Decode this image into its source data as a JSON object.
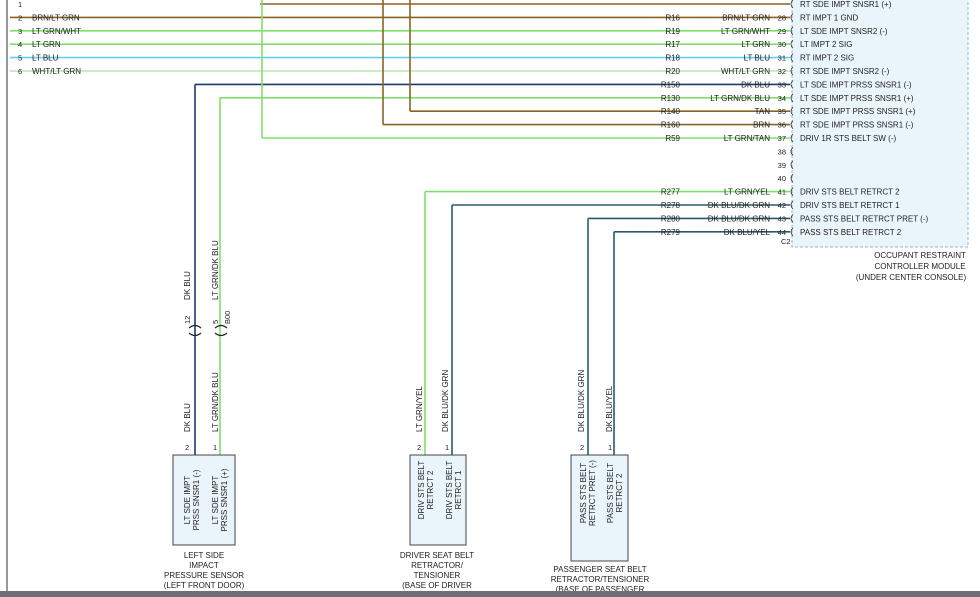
{
  "colors": {
    "brn_lt_grn": "#8a6420",
    "lt_grn": "#7ee06a",
    "lt_blu": "#5fd0f0",
    "dk_blu": "#1c3a6e",
    "dk_blu_dk_grn": "#2a5a6a",
    "brn": "#8a6420",
    "module_fill": "#eaf5fb",
    "connector_fill": "#eaf5fb",
    "bottom_bar": "#6e6e78"
  },
  "left_connector": {
    "rows": [
      {
        "pin": "1",
        "label": "",
        "color": "#8a6420"
      },
      {
        "pin": "2",
        "label": "BRN/LT GRN",
        "color": "#8a6420"
      },
      {
        "pin": "3",
        "label": "LT GRN/WHT",
        "color": "#7ee06a"
      },
      {
        "pin": "4",
        "label": "LT GRN",
        "color": "#7ee06a"
      },
      {
        "pin": "5",
        "label": "LT BLU",
        "color": "#5fd0f0"
      },
      {
        "pin": "6",
        "label": "WHT/LT GRN",
        "color": "#b8e8b0"
      }
    ]
  },
  "module": {
    "name_lines": [
      "OCCUPANT RESTRAINT",
      "CONTROLLER MODULE",
      "(UNDER CENTER CONSOLE)"
    ],
    "connector_id": "C2",
    "pins": [
      {
        "pin": "",
        "circuit": "",
        "wire": "",
        "label": "RT SDE IMPT SNSR1 (+)",
        "color": "#8a6420"
      },
      {
        "pin": "28",
        "circuit": "R16",
        "wire": "BRN/LT GRN",
        "label": "RT IMPT 1 GND",
        "color": "#8a6420"
      },
      {
        "pin": "29",
        "circuit": "R19",
        "wire": "LT GRN/WHT",
        "label": "LT SDE IMPT SNSR2 (-)",
        "color": "#7ee06a"
      },
      {
        "pin": "30",
        "circuit": "R17",
        "wire": "LT GRN",
        "label": "LT IMPT 2 SIG",
        "color": "#7ee06a"
      },
      {
        "pin": "31",
        "circuit": "R18",
        "wire": "LT BLU",
        "label": "RT IMPT 2 SIG",
        "color": "#5fd0f0"
      },
      {
        "pin": "32",
        "circuit": "R20",
        "wire": "WHT/LT GRN",
        "label": "RT SDE IMPT SNSR2 (-)",
        "color": "#b8e8b0"
      },
      {
        "pin": "33",
        "circuit": "R150",
        "wire": "DK BLU",
        "label": "LT SDE IMPT PRSS SNSR1 (-)",
        "color": "#1c3a6e"
      },
      {
        "pin": "34",
        "circuit": "R130",
        "wire": "LT GRN/DK BLU",
        "label": "LT SDE IMPT PRSS SNSR1 (+)",
        "color": "#7ee06a"
      },
      {
        "pin": "35",
        "circuit": "R140",
        "wire": "TAN",
        "label": "RT SDE IMPT PRSS SNSR1 (+)",
        "color": "#8a6420"
      },
      {
        "pin": "36",
        "circuit": "R160",
        "wire": "BRN",
        "label": "RT SDE IMPT PRSS SNSR1 (-)",
        "color": "#8a6420"
      },
      {
        "pin": "37",
        "circuit": "R59",
        "wire": "LT GRN/TAN",
        "label": "DRIV 1R STS BELT SW (-)",
        "color": "#7ee06a"
      },
      {
        "pin": "38",
        "circuit": "",
        "wire": "",
        "label": "",
        "color": ""
      },
      {
        "pin": "39",
        "circuit": "",
        "wire": "",
        "label": "",
        "color": ""
      },
      {
        "pin": "40",
        "circuit": "",
        "wire": "",
        "label": "",
        "color": ""
      },
      {
        "pin": "41",
        "circuit": "R277",
        "wire": "LT GRN/YEL",
        "label": "DRIV STS BELT RETRCT 2",
        "color": "#7ee06a"
      },
      {
        "pin": "42",
        "circuit": "R278",
        "wire": "DK BLU/DK GRN",
        "label": "DRIV STS BELT RETRCT 1",
        "color": "#2a5a6a"
      },
      {
        "pin": "43",
        "circuit": "R280",
        "wire": "DK BLU/DK GRN",
        "label": "PASS STS BELT RETRCT PRET (-)",
        "color": "#2a5a6a"
      },
      {
        "pin": "44",
        "circuit": "R279",
        "wire": "DK BLU/YEL",
        "label": "PASS STS BELT RETRCT 2",
        "color": "#2a5a6a"
      }
    ]
  },
  "inline_connector": {
    "left_pin": "12",
    "right_pin": "5",
    "right_id": "B00",
    "upper_wire_left": "DK BLU",
    "upper_wire_right": "LT GRN/DK BLU",
    "lower_wire_left": "DK BLU",
    "lower_wire_right": "LT GRN/DK BLU"
  },
  "components": [
    {
      "id": "left-side-impact-sensor",
      "pin_labels": [
        "2",
        "1"
      ],
      "wire_labels": [
        "DK BLU",
        "LT GRN/DK BLU"
      ],
      "text_lines": [
        "LT SDE IMPT PRSS SNSR1 (-)",
        "LT SDE IMPT PRSS SNSR1 (+)"
      ],
      "caption": [
        "LEFT SIDE",
        "IMPACT",
        "PRESSURE SENSOR",
        "(LEFT FRONT DOOR)"
      ]
    },
    {
      "id": "driver-seat-belt-retractor",
      "pin_labels": [
        "2",
        "1"
      ],
      "wire_labels": [
        "LT GRN/YEL",
        "DK BLU/DK GRN"
      ],
      "text_lines": [
        "DRIV STS BELT RETRCT 2",
        "DRIV STS BELT RETRCT 1"
      ],
      "caption": [
        "DRIVER SEAT BELT",
        "RETRACTOR/",
        "TENSIONER",
        "(BASE OF DRIVER"
      ]
    },
    {
      "id": "passenger-seat-belt-retractor",
      "pin_labels": [
        "2",
        "1"
      ],
      "wire_labels": [
        "DK BLU/DK GRN",
        "DK BLU/YEL"
      ],
      "text_lines": [
        "PASS STS BELT RETRCT PRET (-)",
        "PASS STS BELT RETRCT 2"
      ],
      "caption": [
        "PASSENGER SEAT BELT",
        "RETRACTOR/TENSIONER",
        "(BASE OF PASSENGER"
      ]
    }
  ]
}
